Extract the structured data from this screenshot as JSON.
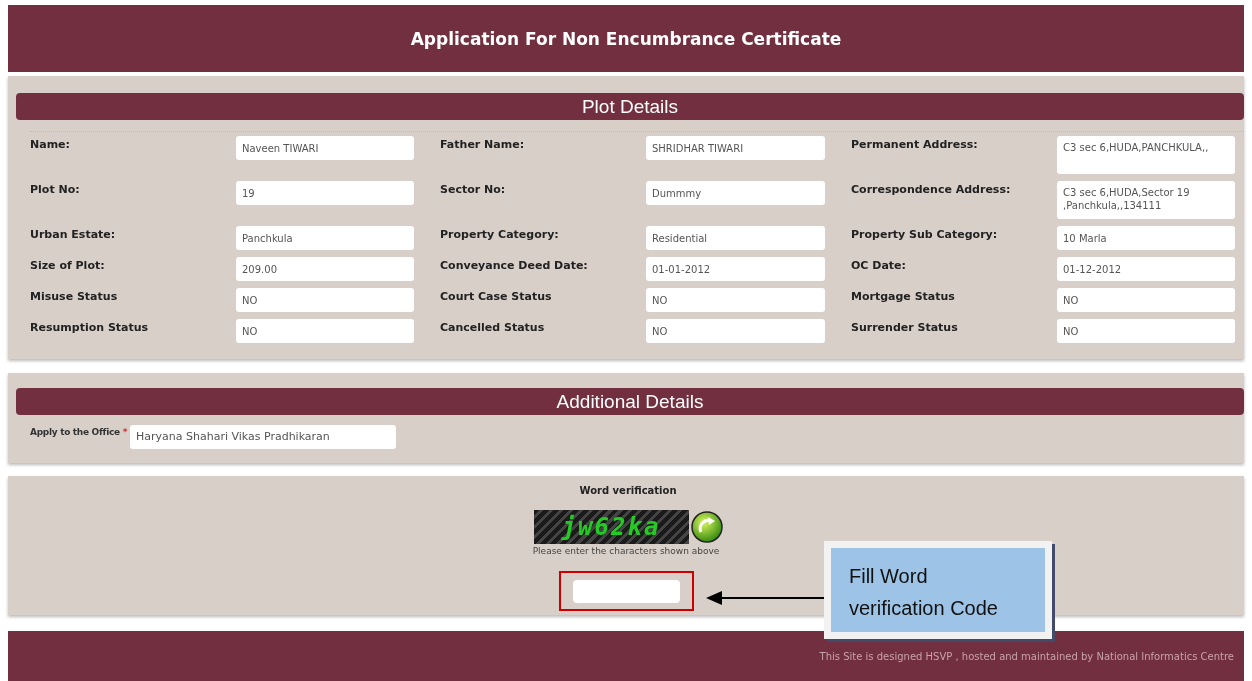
{
  "header": {
    "title": "Application For Non Encumbrance Certificate"
  },
  "plot_details": {
    "heading": "Plot Details",
    "rows": [
      {
        "cells": [
          {
            "label": "Name:",
            "value": "Naveen TIWARI",
            "kind": "single"
          },
          {
            "label": "Father Name:",
            "value": "SHRIDHAR TIWARI",
            "kind": "single"
          },
          {
            "label": "Permanent Address:",
            "value": "C3 sec 6,HUDA,PANCHKULA,,",
            "kind": "multiline"
          }
        ]
      },
      {
        "cells": [
          {
            "label": "Plot No:",
            "value": "19",
            "kind": "single"
          },
          {
            "label": "Sector No:",
            "value": "Dummmy",
            "kind": "single"
          },
          {
            "label": "Correspondence Address:",
            "value": "C3 sec 6,HUDA,Sector 19 ,Panchkula,,134111",
            "kind": "multiline"
          }
        ]
      },
      {
        "cells": [
          {
            "label": "Urban Estate:",
            "value": "Panchkula",
            "kind": "single"
          },
          {
            "label": "Property Category:",
            "value": "Residential",
            "kind": "single"
          },
          {
            "label": "Property Sub Category:",
            "value": "10 Marla",
            "kind": "single"
          }
        ]
      },
      {
        "cells": [
          {
            "label": "Size of Plot:",
            "value": "209.00",
            "kind": "single"
          },
          {
            "label": "Conveyance Deed Date:",
            "value": "01-01-2012",
            "kind": "single"
          },
          {
            "label": "OC Date:",
            "value": "01-12-2012",
            "kind": "single"
          }
        ]
      },
      {
        "cells": [
          {
            "label": "Misuse Status",
            "value": "NO",
            "kind": "single"
          },
          {
            "label": "Court Case Status",
            "value": "NO",
            "kind": "single"
          },
          {
            "label": "Mortgage Status",
            "value": "NO",
            "kind": "single"
          }
        ]
      },
      {
        "cells": [
          {
            "label": "Resumption Status",
            "value": "NO",
            "kind": "single"
          },
          {
            "label": "Cancelled Status",
            "value": "NO",
            "kind": "single"
          },
          {
            "label": "Surrender Status",
            "value": "NO",
            "kind": "single"
          }
        ]
      }
    ]
  },
  "additional_details": {
    "heading": "Additional Details",
    "office_label": "Apply to the Office",
    "required_mark": "*",
    "office_value": "Haryana Shahari Vikas Pradhikaran"
  },
  "word_verification": {
    "title": "Word verification",
    "captcha_text": "jw62ka",
    "hint": "Please enter the characters shown above"
  },
  "callout": {
    "text": "Fill Word verification Code"
  },
  "footer": {
    "text": "This Site is designed HSVP , hosted and maintained by National Informatics Centre"
  }
}
